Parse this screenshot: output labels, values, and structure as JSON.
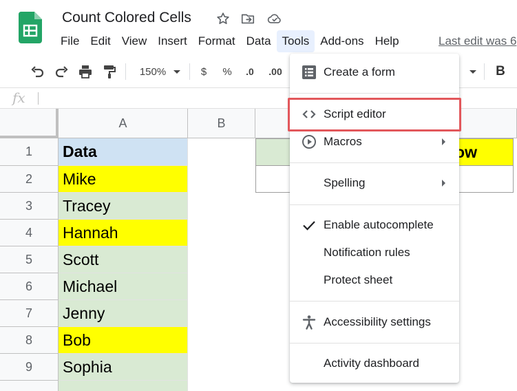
{
  "header": {
    "title": "Count Colored Cells",
    "last_edit": "Last edit was 6"
  },
  "menubar": {
    "items": [
      "File",
      "Edit",
      "View",
      "Insert",
      "Format",
      "Data",
      "Tools",
      "Add-ons",
      "Help"
    ],
    "active": "Tools"
  },
  "toolbar": {
    "zoom": "150%",
    "currency": "$",
    "percent": "%",
    "decrease_decimal": ".0",
    "increase_decimal": ".00",
    "bold": "B"
  },
  "formula_bar": {
    "fx_label": "fx"
  },
  "grid": {
    "columns": [
      "A",
      "B"
    ],
    "rows": [
      {
        "num": "1",
        "a": "Data"
      },
      {
        "num": "2",
        "a": "Mike"
      },
      {
        "num": "3",
        "a": "Tracey"
      },
      {
        "num": "4",
        "a": "Hannah"
      },
      {
        "num": "5",
        "a": "Scott"
      },
      {
        "num": "6",
        "a": "Michael"
      },
      {
        "num": "7",
        "a": "Jenny"
      },
      {
        "num": "8",
        "a": "Bob"
      },
      {
        "num": "9",
        "a": "Sophia"
      }
    ],
    "side_cell_text": "ow",
    "colors": {
      "header_cell": "#cfe2f3",
      "green": "#d9ead3",
      "yellow": "#ffff00"
    }
  },
  "tools_menu": {
    "items": [
      {
        "label": "Create a form",
        "icon": "form-icon",
        "submenu": false
      },
      {
        "label": "Script editor",
        "icon": "code-icon",
        "submenu": false,
        "highlighted": true
      },
      {
        "label": "Macros",
        "icon": "play-circle-icon",
        "submenu": true
      },
      {
        "label": "Spelling",
        "icon": "",
        "submenu": true
      },
      {
        "label": "Enable autocomplete",
        "icon": "check-icon",
        "submenu": false
      },
      {
        "label": "Notification rules",
        "icon": "",
        "submenu": false
      },
      {
        "label": "Protect sheet",
        "icon": "",
        "submenu": false
      },
      {
        "label": "Accessibility settings",
        "icon": "accessibility-icon",
        "submenu": false
      },
      {
        "label": "Activity dashboard",
        "icon": "",
        "submenu": false
      }
    ],
    "highlight_color": "#e2575b"
  }
}
